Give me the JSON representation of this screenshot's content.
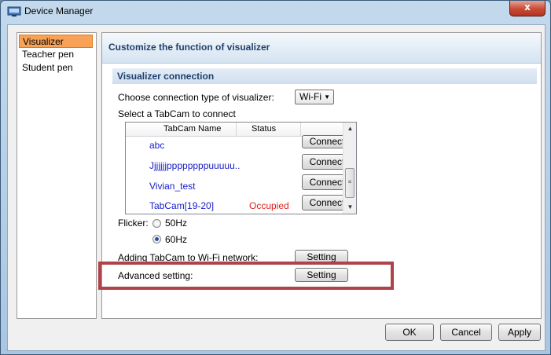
{
  "window": {
    "title": "Device Manager",
    "close_glyph": "x"
  },
  "sidebar": {
    "items": [
      {
        "label": "Visualizer",
        "active": true
      },
      {
        "label": "Teacher pen",
        "active": false
      },
      {
        "label": "Student pen",
        "active": false
      }
    ]
  },
  "panel": {
    "header": "Customize the function of visualizer",
    "section": "Visualizer connection",
    "connection_label": "Choose connection type of visualizer:",
    "connection_value": "Wi-Fi",
    "select_label": "Select a TabCam to connect",
    "columns": {
      "name": "TabCam Name",
      "status": "Status"
    },
    "tabcams": [
      {
        "name": "abc",
        "status": "",
        "action": "Connect"
      },
      {
        "name": "Jjjjjjjppppppppuuuuu..",
        "status": "",
        "action": "Connect"
      },
      {
        "name": "Vivian_test",
        "status": "",
        "action": "Connect"
      },
      {
        "name": "TabCam[19-20]",
        "status": "Occupied",
        "action": "Connect"
      }
    ],
    "flicker_label": "Flicker:",
    "flicker_options": [
      {
        "label": "50Hz",
        "checked": false
      },
      {
        "label": "60Hz",
        "checked": true
      }
    ],
    "wifi_label": "Adding TabCam to Wi-Fi network:",
    "wifi_button": "Setting",
    "advanced_label": "Advanced setting:",
    "advanced_button": "Setting"
  },
  "footer": {
    "ok": "OK",
    "cancel": "Cancel",
    "apply": "Apply"
  },
  "colors": {
    "accent": "#f7a256",
    "link": "#1a20c8",
    "occupied": "#e02020",
    "highlight": "#b0434a"
  },
  "icons": {
    "app": "device-manager-icon",
    "scroll_up": "scroll-up-icon",
    "scroll_down": "scroll-down-icon",
    "dropdown": "chevron-down-icon"
  }
}
